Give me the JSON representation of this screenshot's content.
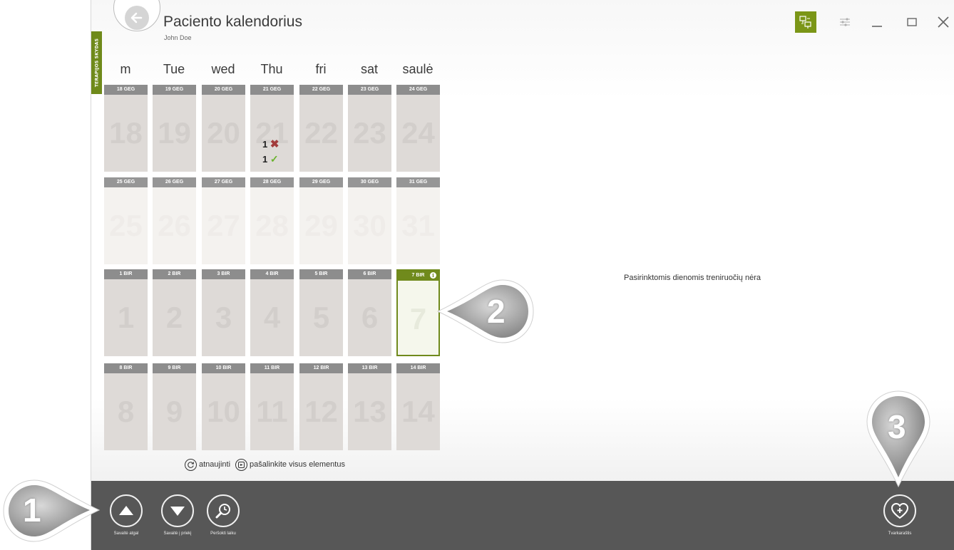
{
  "header": {
    "title": "Paciento kalendorius",
    "patient_name": "John Doe",
    "side_tab": "TERAPIJOS SKYDAS"
  },
  "weekdays": [
    "m",
    "Tue",
    "wed",
    "Thu",
    "fri",
    "sat",
    "saulė"
  ],
  "weeks": [
    {
      "tone": "gray",
      "days": [
        {
          "head": "18 GEG",
          "num": "18"
        },
        {
          "head": "19 GEG",
          "num": "19"
        },
        {
          "head": "20 GEG",
          "num": "20"
        },
        {
          "head": "21 GEG",
          "num": "21"
        },
        {
          "head": "22 GEG",
          "num": "22"
        },
        {
          "head": "23 GEG",
          "num": "23"
        },
        {
          "head": "24 GEG",
          "num": "24"
        }
      ]
    },
    {
      "tone": "light",
      "days": [
        {
          "head": "25 GEG",
          "num": "25"
        },
        {
          "head": "26 GEG",
          "num": "26"
        },
        {
          "head": "27 GEG",
          "num": "27"
        },
        {
          "head": "28 GEG",
          "num": "28"
        },
        {
          "head": "29 GEG",
          "num": "29"
        },
        {
          "head": "30 GEG",
          "num": "30"
        },
        {
          "head": "31 GEG",
          "num": "31"
        }
      ]
    },
    {
      "tone": "gray",
      "days": [
        {
          "head": "1 BIR",
          "num": "1"
        },
        {
          "head": "2 BIR",
          "num": "2"
        },
        {
          "head": "3 BIR",
          "num": "3"
        },
        {
          "head": "4 BIR",
          "num": "4"
        },
        {
          "head": "5 BIR",
          "num": "5"
        },
        {
          "head": "6 BIR",
          "num": "6"
        },
        {
          "head": "7 BIR",
          "num": "7"
        }
      ]
    },
    {
      "tone": "gray",
      "days": [
        {
          "head": "8 BIR",
          "num": "8"
        },
        {
          "head": "9 BIR",
          "num": "9"
        },
        {
          "head": "10 BIR",
          "num": "10"
        },
        {
          "head": "11 BIR",
          "num": "11"
        },
        {
          "head": "12 BIR",
          "num": "12"
        },
        {
          "head": "13 BIR",
          "num": "13"
        },
        {
          "head": "14 BIR",
          "num": "14"
        }
      ]
    }
  ],
  "selected_day": "7 BIR",
  "day_stats": {
    "day": "21 GEG",
    "failed_count": "1",
    "completed_count": "1"
  },
  "actions": {
    "refresh_label": "atnaujinti",
    "remove_all_label": "pašalinkite visus elementus"
  },
  "empty_message": "Pasirinktomis dienomis treniruočių nėra",
  "bottom_bar": {
    "week_back_label": "Savaitė atgal",
    "week_forward_label": "Savaitė į priekį",
    "jump_time_label": "Peršokti laiku",
    "schedule_label": "Tvarkaraštis"
  },
  "callouts": [
    "1",
    "2",
    "3"
  ],
  "colors": {
    "accent": "#7b9617",
    "bottom_bar": "#575757",
    "day_cell": "#dedad7",
    "day_header": "#8d8d8d",
    "fail": "#a23b3b",
    "success": "#6ab32e"
  }
}
